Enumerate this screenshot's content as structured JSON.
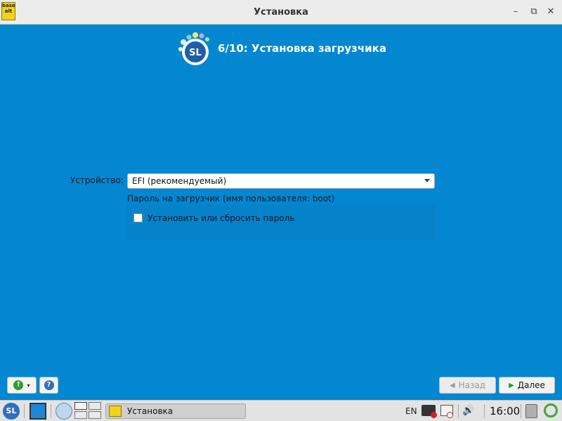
{
  "window": {
    "title": "Установка",
    "app_icon_text": "base alt",
    "controls": {
      "minimize_label": "–",
      "restore_label": "⧉",
      "close_label": "✕"
    }
  },
  "installer": {
    "step_title": "6/10: Установка загрузчика",
    "logo_text": "SL",
    "device": {
      "label": "Устройство:",
      "selected": "EFI (рекомендуемый)"
    },
    "password": {
      "label": "Пароль на загрузчик (имя пользователя: boot)",
      "checkbox_label": "Установить или сбросить пароль",
      "checked": false
    }
  },
  "buttons": {
    "back_label": "Назад",
    "next_label": "Далее",
    "back_enabled": false
  },
  "taskbar": {
    "start_label": "SL",
    "task_label": "Установка",
    "language": "EN",
    "clock": "16:00"
  },
  "colors": {
    "background": "#0287d0",
    "titlebar": "#ececec",
    "taskbar": "#e3e3e3",
    "accent_green": "#2e9d2e"
  }
}
